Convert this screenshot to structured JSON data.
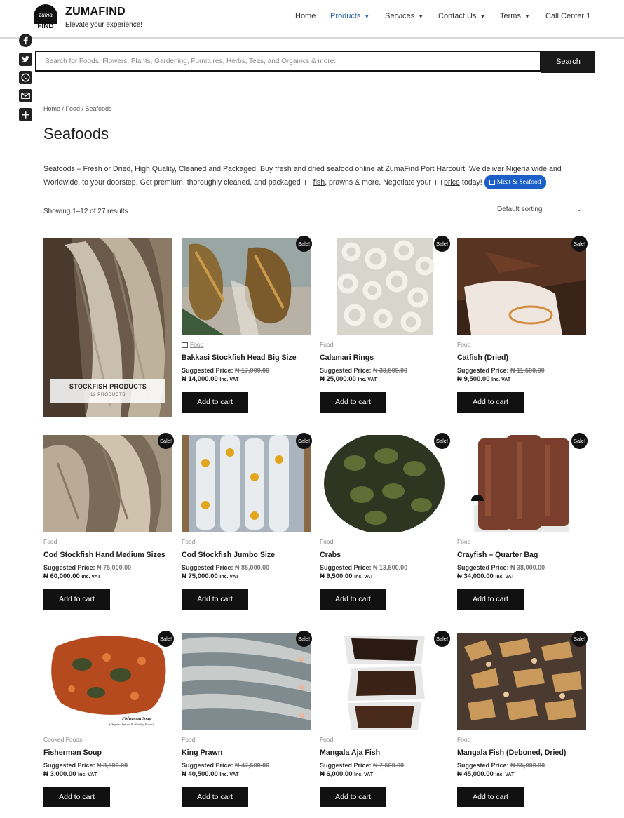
{
  "header": {
    "logo_top": "zuma",
    "logo_bottom": "FIND",
    "brand": "ZUMAFIND",
    "tagline": "Elevate your experience!",
    "nav": [
      {
        "label": "Home"
      },
      {
        "label": "Products"
      },
      {
        "label": "Services"
      },
      {
        "label": "Contact Us"
      },
      {
        "label": "Terms"
      },
      {
        "label": "Call Center 1"
      }
    ],
    "active_nav": "Products",
    "active_color": "#1f5ea8"
  },
  "share": [
    "facebook-icon",
    "twitter-icon",
    "whatsapp-icon",
    "email-icon",
    "share-plus-icon"
  ],
  "search": {
    "placeholder": "Search for Foods, Flowers, Plants, Gardening, Furnitures, Herbs, Teas, and Organics & more..",
    "button": "Search"
  },
  "breadcrumb": "Home / Food / Seafoods",
  "title": "Seafoods",
  "description": {
    "part1": "Seafoods – Fresh or Dried, High Quality, Cleaned and Packaged. Buy fresh and dried seafood online at ZumaFind Port Harcourt. We deliver Nigeria wide and Worldwide, to your doorstep. Get premium, thoroughly cleaned, and packaged ",
    "link1": "fish",
    "part2": ", prawns & more. Negotiate your ",
    "link2": "price",
    "part3": " today! ",
    "pill": "Meat & Seafood"
  },
  "results_count": "Showing 1–12 of 27 results",
  "sorting": "Default sorting",
  "sort_chevron": "⌄",
  "category_card": {
    "title": "STOCKFISH PRODUCTS",
    "count": "12 PRODUCTS"
  },
  "price_label": "Suggested Price:",
  "vat_label": "Inc. VAT",
  "sale_badge": "Sale!",
  "cart_label": "Add to cart",
  "products": [
    {
      "category": "Food",
      "name": "Bakkasi Stockfish Head Big Size",
      "old": "₦ 17,000.00",
      "now": "₦ 14,000.00"
    },
    {
      "category": "Food",
      "name": "Calamari Rings",
      "old": "₦ 33,500.00",
      "now": "₦ 25,000.00"
    },
    {
      "category": "Food",
      "name": "Catfish (Dried)",
      "old": "₦ 11,500.00",
      "now": "₦ 9,500.00"
    },
    {
      "category": "Food",
      "name": "Cod Stockfish Hand Medium Sizes",
      "old": "₦ 75,000.00",
      "now": "₦ 60,000.00"
    },
    {
      "category": "Food",
      "name": "Cod Stockfish Jumbo Size",
      "old": "₦ 85,000.00",
      "now": "₦ 75,000.00"
    },
    {
      "category": "Food",
      "name": "Crabs",
      "old": "₦ 13,500.00",
      "now": "₦ 9,500.00"
    },
    {
      "category": "Food",
      "name": "Crayfish – Quarter Bag",
      "old": "₦ 38,000.00",
      "now": "₦ 34,000.00"
    },
    {
      "category": "Cooked Foods",
      "name": "Fisherman Soup",
      "old": "₦ 3,500.00",
      "now": "₦ 3,000.00"
    },
    {
      "category": "Food",
      "name": "King Prawn",
      "old": "₦ 47,500.00",
      "now": "₦ 40,500.00"
    },
    {
      "category": "Food",
      "name": "Mangala Aja Fish",
      "old": "₦ 7,500.00",
      "now": "₦ 6,000.00"
    },
    {
      "category": "Food",
      "name": "Mangala Fish (Deboned, Dried)",
      "old": "₦ 55,000.00",
      "now": "₦ 45,000.00"
    }
  ],
  "image_text": {
    "fisherman_soup_caption": "Fisherman Soup",
    "fisherman_soup_sub": "(Organic Spiced & Healthy Foods)"
  }
}
